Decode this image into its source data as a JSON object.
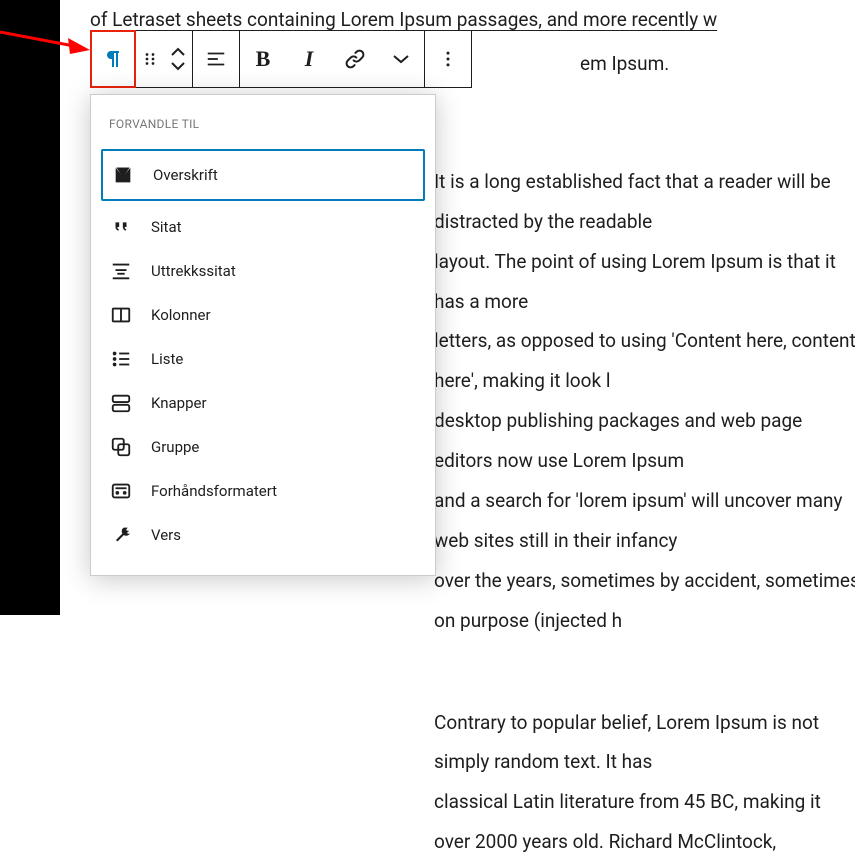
{
  "article": {
    "line_top": "of Letraset sheets containing Lorem Ipsum passages, and more recently w",
    "line_ipsum": "em Ipsum.",
    "mid_lines": [
      "It is a long established fact that a reader will be distracted by the readable",
      "layout. The point of using Lorem Ipsum is that it has a more",
      "letters, as opposed to using 'Content here, content here', making it look l",
      "desktop publishing packages and web page editors now use Lorem Ipsum",
      "and a search for 'lorem ipsum' will uncover many web sites still in their infancy",
      "over the years, sometimes by accident, sometimes on purpose (injected h"
    ],
    "bottom_lines": [
      "Contrary to popular belief, Lorem Ipsum is not simply random text. It has",
      "classical Latin literature from 45 BC, making it over 2000 years old. Richard McClintock,"
    ]
  },
  "popover": {
    "heading": "FORVANDLE TIL",
    "items": [
      {
        "label": "Overskrift"
      },
      {
        "label": "Sitat"
      },
      {
        "label": "Uttrekkssitat"
      },
      {
        "label": "Kolonner"
      },
      {
        "label": "Liste"
      },
      {
        "label": "Knapper"
      },
      {
        "label": "Gruppe"
      },
      {
        "label": "Forhåndsformatert"
      },
      {
        "label": "Vers"
      }
    ]
  }
}
